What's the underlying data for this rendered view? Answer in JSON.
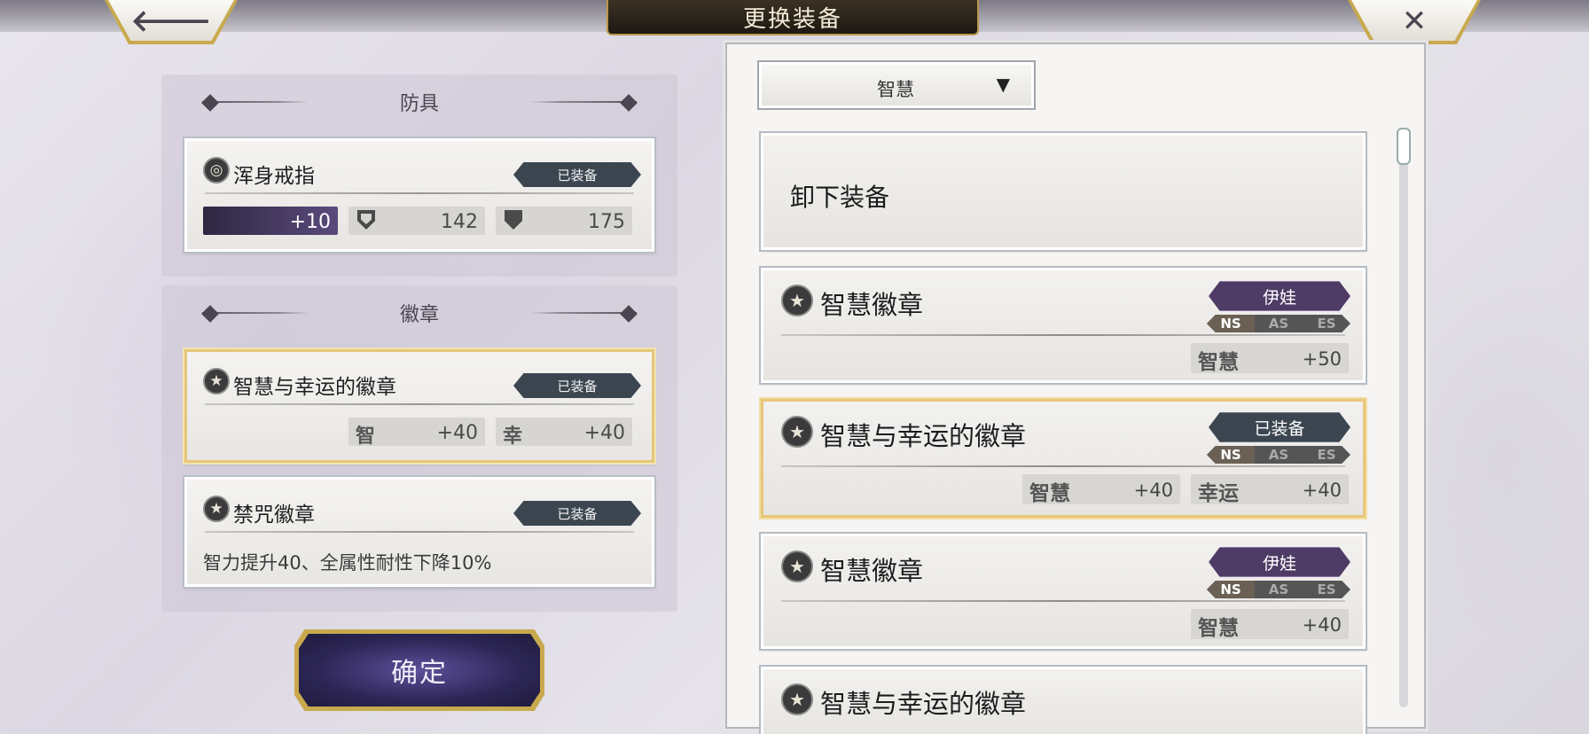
{
  "header": {
    "title": "更换装备",
    "back_glyph": "🡐",
    "close_glyph": "✕"
  },
  "left": {
    "armor_section": {
      "title": "防具",
      "item": {
        "name": "浑身戒指",
        "status": "已装备",
        "enhance": "+10",
        "stat1": "142",
        "stat2": "175"
      }
    },
    "badge_section": {
      "title": "徽章",
      "items": [
        {
          "name": "智慧与幸运的徽章",
          "status": "已装备",
          "stats": [
            {
              "label": "智",
              "value": "+40"
            },
            {
              "label": "幸",
              "value": "+40"
            }
          ]
        },
        {
          "name": "禁咒徽章",
          "status": "已装备",
          "description": "智力提升40、全属性耐性下降10%"
        }
      ]
    },
    "confirm_label": "确定"
  },
  "right": {
    "filter": {
      "selected": "智慧",
      "arrow": "▼"
    },
    "unequip_label": "卸下装备",
    "items": [
      {
        "name": "智慧徽章",
        "owner": "伊娃",
        "tags": [
          "NS",
          "AS",
          "ES"
        ],
        "stats": [
          {
            "label": "智慧",
            "value": "+50"
          }
        ]
      },
      {
        "name": "智慧与幸运的徽章",
        "owner": "已装备",
        "tags": [
          "NS",
          "AS",
          "ES"
        ],
        "stats": [
          {
            "label": "智慧",
            "value": "+40"
          },
          {
            "label": "幸运",
            "value": "+40"
          }
        ]
      },
      {
        "name": "智慧徽章",
        "owner": "伊娃",
        "tags": [
          "NS",
          "AS",
          "ES"
        ],
        "stats": [
          {
            "label": "智慧",
            "value": "+40"
          }
        ]
      },
      {
        "name": "智慧与幸运的徽章"
      }
    ]
  },
  "colors": {
    "gold": "#e5c77a",
    "purple": "#4e3c66",
    "equipped": "#3b4650"
  }
}
